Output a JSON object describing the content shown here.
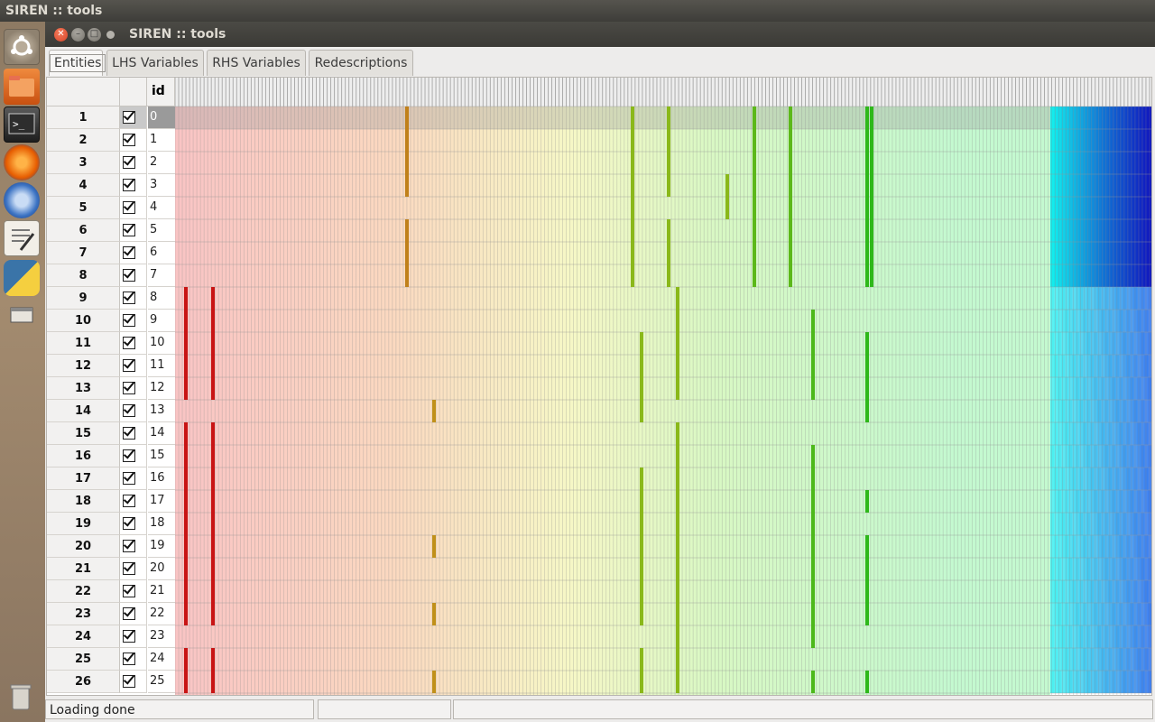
{
  "system_title": "SIREN :: tools",
  "launcher": {
    "items": [
      {
        "name": "dash-button",
        "icon": "ubuntu-logo-icon",
        "color": "#8a7a66"
      },
      {
        "name": "files-button",
        "icon": "folder-icon",
        "color": "#e8702a"
      },
      {
        "name": "terminal-button",
        "icon": "terminal-icon",
        "color": "#2b2b2b"
      },
      {
        "name": "firefox-button",
        "icon": "firefox-icon",
        "color": "#e66000"
      },
      {
        "name": "thunderbird-button",
        "icon": "thunderbird-icon",
        "color": "#2a5aa8"
      },
      {
        "name": "text-editor-button",
        "icon": "text-editor-icon",
        "color": "#ebe7de"
      },
      {
        "name": "python-button",
        "icon": "python-icon",
        "color": "#3f79ae"
      },
      {
        "name": "window-button",
        "icon": "window-icon",
        "color": "#6b6457"
      },
      {
        "name": "trash-button",
        "icon": "trash-icon",
        "color": "#9a8f80"
      }
    ]
  },
  "window": {
    "title": "SIREN :: tools",
    "controls": {
      "close": "close-icon",
      "minimize": "minimize-icon",
      "maximize": "maximize-icon",
      "menu": "window-menu-icon"
    }
  },
  "tabs": [
    {
      "label": "Entities",
      "active": true
    },
    {
      "label": "LHS Variables",
      "active": false
    },
    {
      "label": "RHS Variables",
      "active": false
    },
    {
      "label": "Redescriptions",
      "active": false
    }
  ],
  "grid": {
    "id_header": "id",
    "rows": [
      {
        "num": "1",
        "id": "0",
        "checked": true,
        "selected": true
      },
      {
        "num": "2",
        "id": "1",
        "checked": true
      },
      {
        "num": "3",
        "id": "2",
        "checked": true
      },
      {
        "num": "4",
        "id": "3",
        "checked": true
      },
      {
        "num": "5",
        "id": "4",
        "checked": true
      },
      {
        "num": "6",
        "id": "5",
        "checked": true
      },
      {
        "num": "7",
        "id": "6",
        "checked": true
      },
      {
        "num": "8",
        "id": "7",
        "checked": true
      },
      {
        "num": "9",
        "id": "8",
        "checked": true
      },
      {
        "num": "10",
        "id": "9",
        "checked": true
      },
      {
        "num": "11",
        "id": "10",
        "checked": true
      },
      {
        "num": "12",
        "id": "11",
        "checked": true
      },
      {
        "num": "13",
        "id": "12",
        "checked": true
      },
      {
        "num": "14",
        "id": "13",
        "checked": true
      },
      {
        "num": "15",
        "id": "14",
        "checked": true
      },
      {
        "num": "16",
        "id": "15",
        "checked": true
      },
      {
        "num": "17",
        "id": "16",
        "checked": true
      },
      {
        "num": "18",
        "id": "17",
        "checked": true
      },
      {
        "num": "19",
        "id": "18",
        "checked": true
      },
      {
        "num": "20",
        "id": "19",
        "checked": true
      },
      {
        "num": "21",
        "id": "20",
        "checked": true
      },
      {
        "num": "22",
        "id": "21",
        "checked": true
      },
      {
        "num": "23",
        "id": "22",
        "checked": true
      },
      {
        "num": "24",
        "id": "23",
        "checked": true
      },
      {
        "num": "25",
        "id": "24",
        "checked": true
      },
      {
        "num": "26",
        "id": "25",
        "checked": true
      }
    ]
  },
  "status": {
    "message": "Loading done"
  }
}
